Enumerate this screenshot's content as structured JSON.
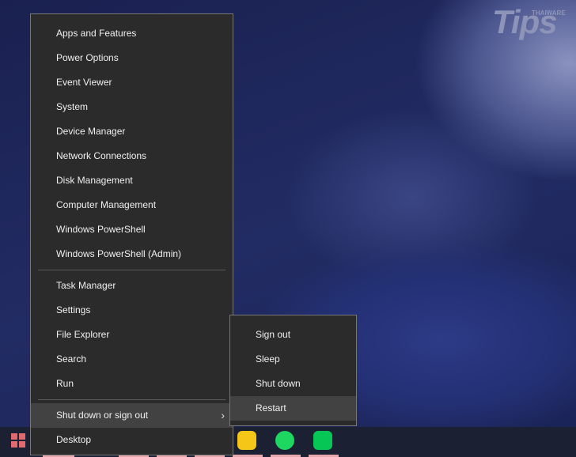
{
  "logo": {
    "text": "Tips",
    "brand": "THAIWARE"
  },
  "menu": {
    "items": [
      "Apps and Features",
      "Power Options",
      "Event Viewer",
      "System",
      "Device Manager",
      "Network Connections",
      "Disk Management",
      "Computer Management",
      "Windows PowerShell",
      "Windows PowerShell (Admin)"
    ],
    "items2": [
      "Task Manager",
      "Settings",
      "File Explorer",
      "Search",
      "Run"
    ],
    "shutdown": "Shut down or sign out",
    "desktop": "Desktop"
  },
  "submenu": {
    "items": [
      "Sign out",
      "Sleep",
      "Shut down",
      "Restart"
    ]
  },
  "colors": {
    "accent": "#e06a6e",
    "hover": "#424242"
  }
}
